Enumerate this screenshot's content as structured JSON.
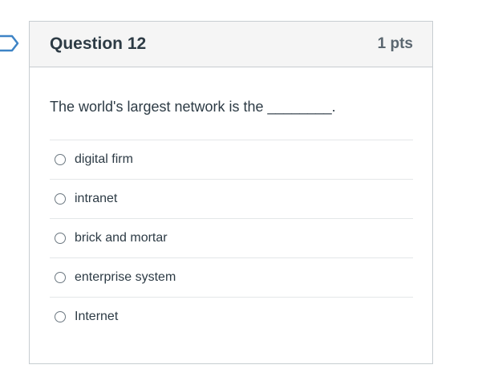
{
  "question": {
    "title": "Question 12",
    "points": "1 pts",
    "text": "The world's largest network is the ________."
  },
  "answers": [
    {
      "label": "digital firm"
    },
    {
      "label": "intranet"
    },
    {
      "label": "brick and mortar"
    },
    {
      "label": "enterprise system"
    },
    {
      "label": "Internet"
    }
  ],
  "icons": {
    "flag": "flag-outline-icon"
  },
  "colors": {
    "header_bg": "#f5f5f5",
    "border": "#c7cdd1",
    "text": "#2d3b45",
    "flag": "#3e84c6"
  }
}
